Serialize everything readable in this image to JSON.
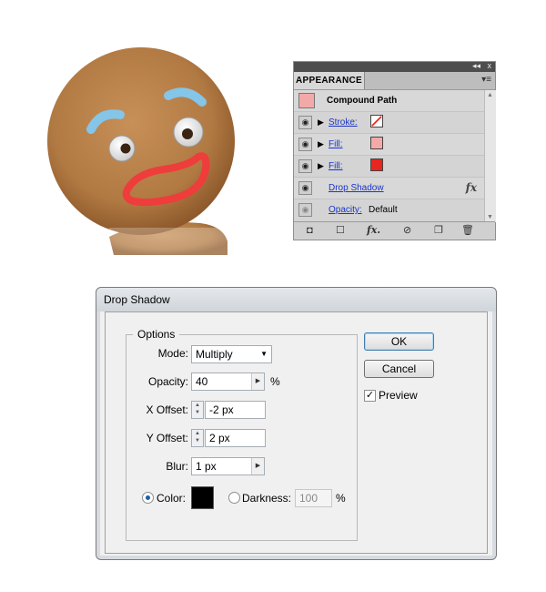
{
  "appearance_panel": {
    "tab_label": "APPEARANCE",
    "controls": {
      "collapse": "◂◂",
      "close": "x",
      "menu": "▾≡"
    },
    "object_label": "Compound Path",
    "object_thumb_color": "#f4a9a9",
    "rows": [
      {
        "label": "Stroke:",
        "swatch": "none-stroke"
      },
      {
        "label": "Fill:",
        "swatch_color": "#f4a9a9"
      },
      {
        "label": "Fill:",
        "swatch_color": "#e8261f"
      },
      {
        "label": "Drop Shadow",
        "fx": "fx"
      },
      {
        "label": "Opacity:",
        "value": "Default"
      }
    ],
    "bottom_icons": [
      "new-layer-icon",
      "add-stroke-icon",
      "fx-icon",
      "clear-icon",
      "duplicate-icon",
      "trash-icon"
    ]
  },
  "dialog": {
    "title": "Drop Shadow",
    "options_legend": "Options",
    "mode": {
      "label": "Mode:",
      "value": "Multiply"
    },
    "opacity": {
      "label": "Opacity:",
      "value": "40",
      "unit": "%"
    },
    "x_offset": {
      "label": "X Offset:",
      "value": "-2 px"
    },
    "y_offset": {
      "label": "Y Offset:",
      "value": "2 px"
    },
    "blur": {
      "label": "Blur:",
      "value": "1 px"
    },
    "color": {
      "label": "Color:",
      "selected": true,
      "swatch": "#000000"
    },
    "darkness": {
      "label": "Darkness:",
      "value": "100",
      "unit": "%",
      "selected": false
    },
    "ok_label": "OK",
    "cancel_label": "Cancel",
    "preview": {
      "label": "Preview",
      "checked": true
    }
  }
}
